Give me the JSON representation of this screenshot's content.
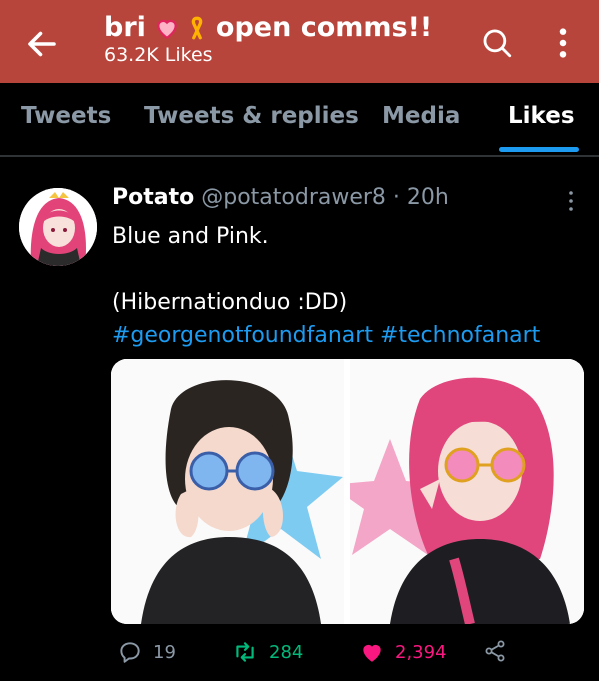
{
  "header": {
    "title_name": "bri",
    "title_suffix": "open comms!!",
    "likes_count": "63.2K Likes",
    "emoji_heart": "heart-emoji",
    "emoji_ribbon": "ribbon-emoji"
  },
  "tabs": [
    {
      "label": "Tweets"
    },
    {
      "label": "Tweets & replies"
    },
    {
      "label": "Media"
    },
    {
      "label": "Likes"
    }
  ],
  "tweet": {
    "name": "Potato",
    "handle": "@potatodrawer8",
    "separator": "·",
    "time": "20h",
    "line1": "Blue and Pink.",
    "line2": "(Hibernationduo :DD)",
    "hashtags": "#georgenotfoundfanart #technofanart",
    "replies": "19",
    "retweets": "284",
    "likes": "2,394"
  },
  "colors": {
    "topbar": "#b8453b",
    "accent": "#1d9bf0",
    "retweet": "#00ba7c",
    "like": "#f91880",
    "muted": "#8b98a5"
  }
}
